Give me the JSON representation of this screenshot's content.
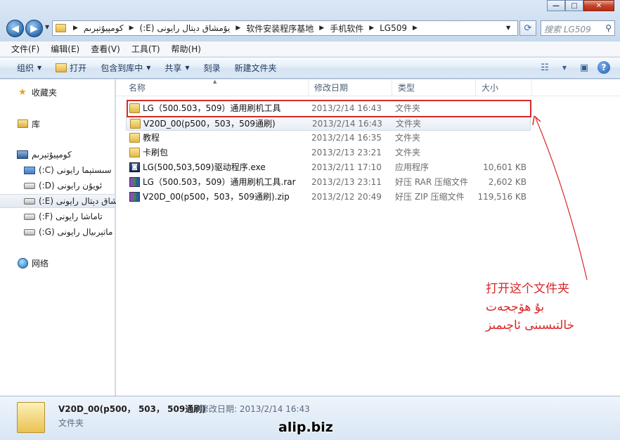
{
  "window": {
    "minimize_glyph": "—",
    "maximize_glyph": "□",
    "close_glyph": "✕"
  },
  "address": {
    "crumbs": [
      "كومپيۇتېرىم",
      "يۇمشاق دېتال رايونى (E:)",
      "软件安装程序基地",
      "手机软件",
      "LG509"
    ],
    "search_placeholder": "搜索 LG509"
  },
  "menubar": [
    "文件(F)",
    "编辑(E)",
    "查看(V)",
    "工具(T)",
    "帮助(H)"
  ],
  "toolbar": {
    "organize": "组织",
    "open": "打开",
    "include_library": "包含到库中",
    "share": "共享",
    "burn": "刻录",
    "new_folder": "新建文件夹"
  },
  "sidebar": {
    "favorites": "收藏夹",
    "libraries": "库",
    "computer": "كومپيۇتېرىم",
    "drives": [
      "سىستېما رايونى (C:)",
      "ئويۇن رايونى (D:)",
      "يۇمشاق دېتال رايونى (E:)",
      "تاماشا رايونى (F:)",
      "ماتېرىيال رايونى (G:)"
    ],
    "network": "网络"
  },
  "columns": {
    "name": "名称",
    "date": "修改日期",
    "type": "类型",
    "size": "大小"
  },
  "files": [
    {
      "name": "LG（500.503，509）通用刷机工具",
      "date": "2013/2/14 16:43",
      "type": "文件夹",
      "size": "",
      "icon": "folder"
    },
    {
      "name": "V20D_00(p500，503，509通刷)",
      "date": "2013/2/14 16:43",
      "type": "文件夹",
      "size": "",
      "icon": "folder"
    },
    {
      "name": "教程",
      "date": "2013/2/14 16:35",
      "type": "文件夹",
      "size": "",
      "icon": "folder"
    },
    {
      "name": "卡刷包",
      "date": "2013/2/13 23:21",
      "type": "文件夹",
      "size": "",
      "icon": "folder"
    },
    {
      "name": "LG(500,503,509)驱动程序.exe",
      "date": "2013/2/11 17:10",
      "type": "应用程序",
      "size": "10,601 KB",
      "icon": "exe"
    },
    {
      "name": "LG（500.503，509）通用刷机工具.rar",
      "date": "2013/2/13 23:11",
      "type": "好压 RAR 压缩文件",
      "size": "2,602 KB",
      "icon": "rar"
    },
    {
      "name": "V20D_00(p500，503，509通刷).zip",
      "date": "2013/2/12 20:49",
      "type": "好压 ZIP 压缩文件",
      "size": "119,516 KB",
      "icon": "zip"
    }
  ],
  "annotation": {
    "line1": "打开这个文件夹",
    "line2": "بۇ ھۆججەت",
    "line3": "خالتىسىنى ئاچىمىز",
    "color": "#d8262a"
  },
  "details": {
    "name": "V20D_00(p500， 503， 509通刷)",
    "modified_label": "修改日期:",
    "modified": "2013/2/14 16:43",
    "type": "文件夹"
  },
  "watermark": "alip.biz"
}
